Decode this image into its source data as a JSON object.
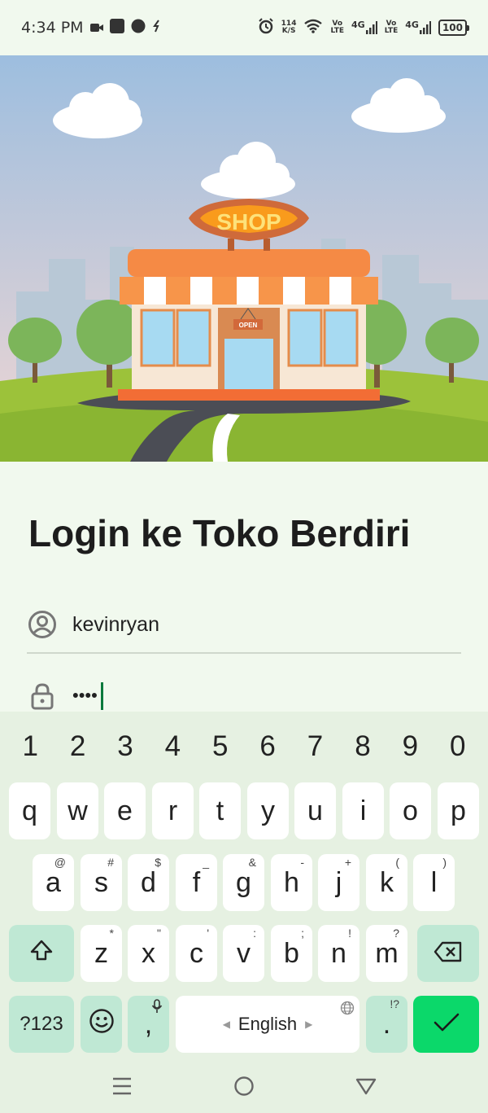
{
  "status_bar": {
    "time": "4:34 PM",
    "net_speed_top": "114",
    "net_speed_bottom": "K/S",
    "sim1_top": "Vo",
    "sim1_bottom": "LTE",
    "sim1_net": "4G",
    "sim2_top": "Vo",
    "sim2_bottom": "LTE",
    "sim2_net": "4G",
    "battery": "100"
  },
  "hero": {
    "sign_text": "SHOP",
    "door_sign": "OPEN",
    "colors": {
      "sky_top": "#9dbedf",
      "sky_bottom": "#f0d6d3",
      "grass": "#9cc23a",
      "awning": "#f58a45",
      "sign": "#f99b1c"
    }
  },
  "login": {
    "title": "Login ke Toko Berdiri",
    "username_value": "kevinryan",
    "password_value": "••••"
  },
  "keyboard": {
    "numbers": [
      "1",
      "2",
      "3",
      "4",
      "5",
      "6",
      "7",
      "8",
      "9",
      "0"
    ],
    "row1": [
      "q",
      "w",
      "e",
      "r",
      "t",
      "y",
      "u",
      "i",
      "o",
      "p"
    ],
    "row2": [
      {
        "key": "a",
        "hint": "@"
      },
      {
        "key": "s",
        "hint": "#"
      },
      {
        "key": "d",
        "hint": "$"
      },
      {
        "key": "f",
        "hint": "_"
      },
      {
        "key": "g",
        "hint": "&"
      },
      {
        "key": "h",
        "hint": "-"
      },
      {
        "key": "j",
        "hint": "+"
      },
      {
        "key": "k",
        "hint": "("
      },
      {
        "key": "l",
        "hint": ")"
      }
    ],
    "row3": [
      {
        "key": "z",
        "hint": "*"
      },
      {
        "key": "x",
        "hint": "\""
      },
      {
        "key": "c",
        "hint": "'"
      },
      {
        "key": "v",
        "hint": ":"
      },
      {
        "key": "b",
        "hint": ";"
      },
      {
        "key": "n",
        "hint": "!"
      },
      {
        "key": "m",
        "hint": "?"
      }
    ],
    "symbols_label": "?123",
    "comma_label": ",",
    "space_label": "English",
    "period_label": ".",
    "period_hint": "!?",
    "enter_color": "#0bd86a"
  },
  "icons": {
    "user": "user-circle-icon",
    "password": "lock-icon",
    "shift": "shift-icon",
    "backspace": "backspace-icon",
    "emoji": "emoji-icon",
    "mic": "mic-icon",
    "globe": "globe-icon",
    "enter": "checkmark-icon"
  }
}
